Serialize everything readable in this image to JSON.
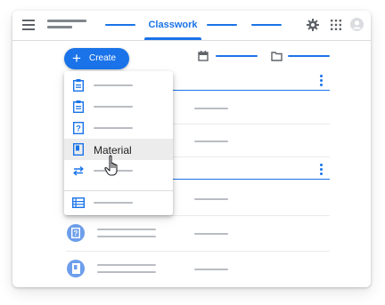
{
  "header": {
    "menu_icon": "hamburger-menu-icon",
    "active_tab": "Classwork",
    "settings_icon": "gear-icon",
    "apps_icon": "apps-grid-icon",
    "account_icon": "account-avatar-icon"
  },
  "toolbar": {
    "create_label": "Create",
    "create_icon": "plus-icon",
    "calendar_icon": "calendar-icon",
    "folder_icon": "folder-icon"
  },
  "create_menu": {
    "items": [
      {
        "icon": "assignment-icon",
        "label": ""
      },
      {
        "icon": "quiz-assignment-icon",
        "label": ""
      },
      {
        "icon": "question-icon",
        "label": ""
      },
      {
        "icon": "material-icon",
        "label": "Material"
      },
      {
        "icon": "reuse-post-icon",
        "label": ""
      },
      {
        "icon": "topic-icon",
        "label": ""
      }
    ],
    "cursor_icon": "hand-pointer-cursor-icon"
  },
  "stream": {
    "question_icon": "question-icon",
    "material_icon": "material-icon",
    "more_icon": "more-vert-icon"
  },
  "colors": {
    "accent": "#1a73e8",
    "icon_circle": "#6d9eeb",
    "placeholder": "#b9bdc3",
    "highlight": "#ececec"
  }
}
